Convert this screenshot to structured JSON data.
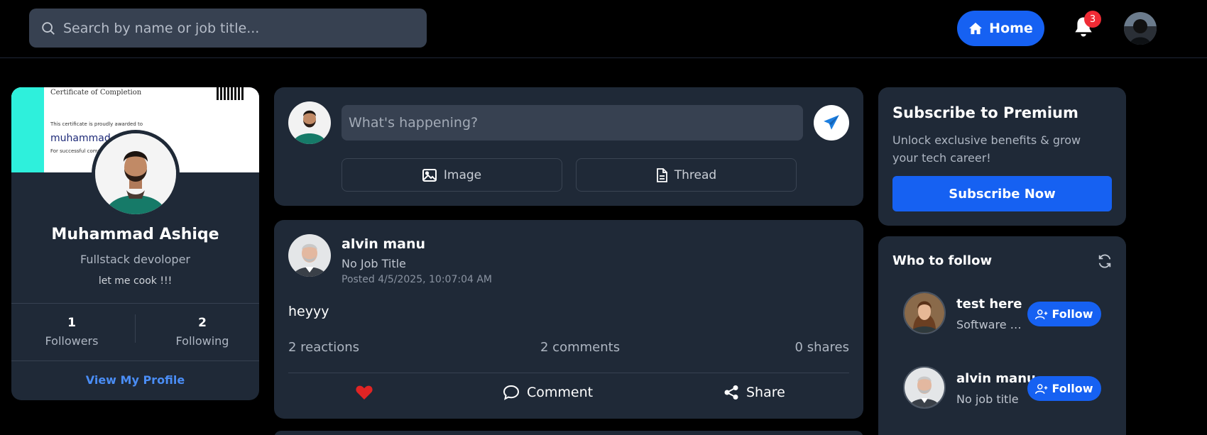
{
  "header": {
    "search_placeholder": "Search by name or job title...",
    "home_label": "Home",
    "notification_count": "3"
  },
  "profile": {
    "cover": {
      "certificate_title": "Certificate of Completion",
      "certificate_line": "This certificate is proudly awarded to",
      "certificate_name": "muhammad",
      "certificate_sub": "For successful compl"
    },
    "name": "Muhammad Ashiqe",
    "role": "Fullstack devoloper",
    "bio": "let me cook !!!",
    "followers_count": "1",
    "followers_label": "Followers",
    "following_count": "2",
    "following_label": "Following",
    "view_profile_label": "View My Profile"
  },
  "composer": {
    "placeholder": "What's happening?",
    "image_label": "Image",
    "thread_label": "Thread"
  },
  "post": {
    "author": "alvin manu",
    "job_title": "No Job Title",
    "posted": "Posted 4/5/2025, 10:07:04 AM",
    "body": "heyyy",
    "reactions": "2 reactions",
    "comments": "2 comments",
    "shares": "0 shares",
    "comment_label": "Comment",
    "share_label": "Share"
  },
  "premium": {
    "title": "Subscribe to Premium",
    "description": "Unlock exclusive benefits & grow your tech career!",
    "button_label": "Subscribe Now"
  },
  "who_to_follow": {
    "title": "Who to follow",
    "items": [
      {
        "name": "test here",
        "subtitle": "Software Engineer",
        "button_label": "Follow"
      },
      {
        "name": "alvin manu",
        "subtitle": "No job title",
        "button_label": "Follow"
      }
    ]
  },
  "colors": {
    "accent": "#1661f2",
    "card": "#1f2937",
    "badge": "#ef2b35",
    "link": "#4a8df5",
    "heart": "#e02424"
  }
}
